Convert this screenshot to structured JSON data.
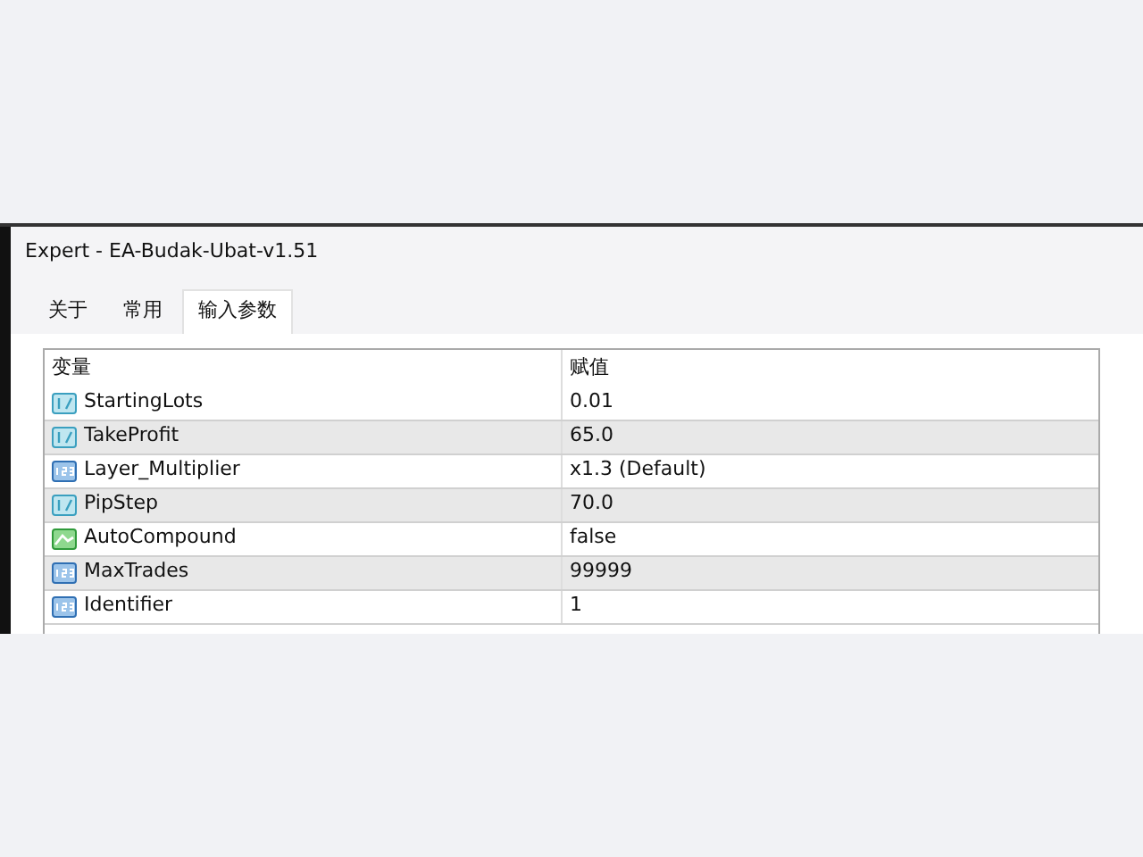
{
  "window": {
    "title": "Expert - EA-Budak-Ubat-v1.51"
  },
  "tabs": [
    {
      "label": "关于",
      "selected": false
    },
    {
      "label": "常用",
      "selected": false
    },
    {
      "label": "输入参数",
      "selected": true
    }
  ],
  "table": {
    "columns": [
      "变量",
      "赋值"
    ],
    "rows": [
      {
        "kind": "double",
        "name": "StartingLots",
        "value": "0.01"
      },
      {
        "kind": "double",
        "name": "TakeProfit",
        "value": "65.0"
      },
      {
        "kind": "int",
        "name": "Layer_Multiplier",
        "value": "x1.3 (Default)"
      },
      {
        "kind": "double",
        "name": "PipStep",
        "value": "70.0"
      },
      {
        "kind": "bool",
        "name": "AutoCompound",
        "value": "false"
      },
      {
        "kind": "int",
        "name": "MaxTrades",
        "value": "99999"
      },
      {
        "kind": "int",
        "name": "Identifier",
        "value": "1"
      }
    ]
  }
}
